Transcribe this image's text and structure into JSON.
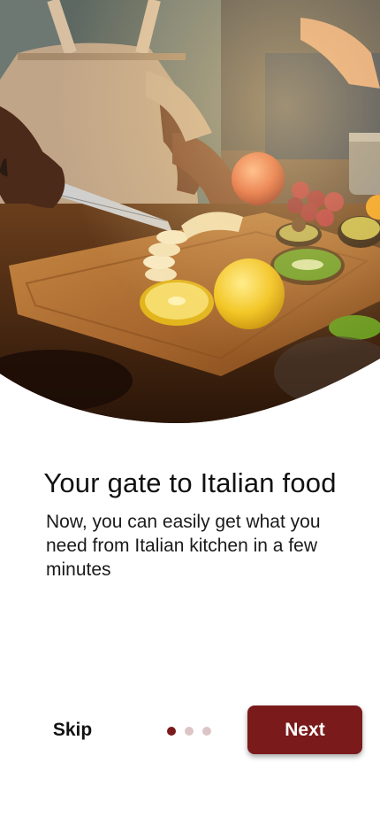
{
  "onboarding": {
    "title": "Your gate to Italian food",
    "subtitle": "Now, you can easily get what you need from Italian kitchen in a few minutes",
    "skip_label": "Skip",
    "next_label": "Next",
    "page_indicator": {
      "total": 3,
      "current": 1
    }
  },
  "colors": {
    "primary": "#7a1a1a",
    "dot_inactive": "#dcc5c7",
    "background": "#ffffff",
    "text": "#111111"
  },
  "hero": {
    "icon": "cooking-photo"
  }
}
